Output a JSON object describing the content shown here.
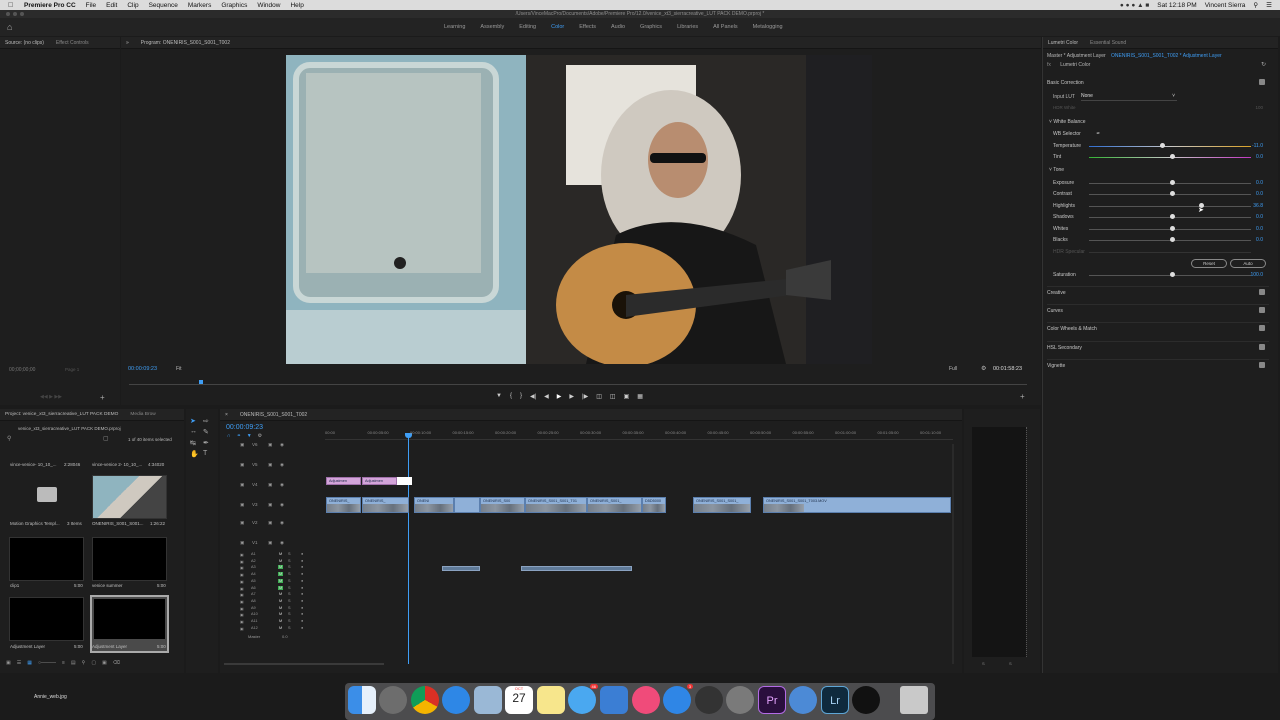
{
  "menubar": {
    "app": "Premiere Pro CC",
    "items": [
      "File",
      "Edit",
      "Clip",
      "Sequence",
      "Markers",
      "Graphics",
      "Window",
      "Help"
    ],
    "clock": "Sat 12:18 PM",
    "user": "Vincent Sierra"
  },
  "titlebar": {
    "path": "/Users/VinceMacPro/Documents/Adobe/Premiere Pro/12.0/venice_xt3_sierracreative_LUT PACK DEMO.prproj *"
  },
  "workspaces": {
    "tabs": [
      "Learning",
      "Assembly",
      "Editing",
      "Color",
      "Effects",
      "Audio",
      "Graphics",
      "Libraries",
      "All Panels",
      "Metalogging"
    ],
    "active": "Color"
  },
  "source": {
    "tab1": "Source: (no clips)",
    "tab2": "Effect Controls",
    "timecode": "00;00;00;00",
    "page": "Page 1"
  },
  "program": {
    "tab": "Program: ONENIRIS_S001_S001_T002",
    "timecode": "00:00:09:23",
    "fit": "Fit",
    "quality": "Full",
    "duration": "00:01:58:23"
  },
  "lumetri": {
    "tab1": "Lumetri Color",
    "tab2": "Essential Sound",
    "master": "Master * Adjustment Layer",
    "clip": "ONENIRIS_S001_S001_T002 * Adjustment Layer",
    "fx_label": "fx",
    "fx_name": "Lumetri Color",
    "basic": "Basic Correction",
    "input_lut_label": "Input LUT",
    "input_lut": "None",
    "hdr_white": "HDR White",
    "hdr_white_val": "100",
    "white_balance": "White Balance",
    "wb_selector": "WB Selector",
    "tone": "Tone",
    "hdr_specular": "HDR Specular",
    "reset": "Reset",
    "auto": "Auto",
    "sliders": [
      {
        "label": "Temperature",
        "value": "-11.0",
        "pos": 0.44
      },
      {
        "label": "Tint",
        "value": "0.0",
        "pos": 0.5
      },
      {
        "label": "Exposure",
        "value": "0.0",
        "pos": 0.5
      },
      {
        "label": "Contrast",
        "value": "0.0",
        "pos": 0.5
      },
      {
        "label": "Highlights",
        "value": "36.8",
        "pos": 0.68
      },
      {
        "label": "Shadows",
        "value": "0.0",
        "pos": 0.5
      },
      {
        "label": "Whites",
        "value": "0.0",
        "pos": 0.5
      },
      {
        "label": "Blacks",
        "value": "0.0",
        "pos": 0.5
      }
    ],
    "saturation": {
      "label": "Saturation",
      "value": "100.0",
      "pos": 0.5
    },
    "sections": [
      "Creative",
      "Curves",
      "Color Wheels & Match",
      "HSL Secondary",
      "Vignette"
    ]
  },
  "project": {
    "tab": "Project: venice_xt3_sierracreative_LUT PACK DEMO",
    "tab2": "Media Brow",
    "file": "venice_xt3_sierracreative_LUT PACK DEMO.prproj",
    "count": "1 of 40 items selected",
    "items": [
      {
        "name": "vince-venice- 10_10_...",
        "dur": "2:28046"
      },
      {
        "name": "vince-venice 2- 10_10_...",
        "dur": "4:34020"
      },
      {
        "name": "Motion Graphics Templ...",
        "dur": "3 Items"
      },
      {
        "name": "ONENIRIS_S001_S001...",
        "dur": "1:26:22"
      },
      {
        "name": "clip1",
        "dur": "5:00"
      },
      {
        "name": "venice summer",
        "dur": "5:00"
      },
      {
        "name": "Adjustment Layer",
        "dur": "5:00"
      },
      {
        "name": "Adjustment Layer",
        "dur": "5:00"
      }
    ]
  },
  "timeline": {
    "tab": "ONENIRIS_S001_S001_T002",
    "timecode": "00:00:09:23",
    "ruler": [
      "00:00",
      "00:00:05:00",
      "00:00:10:00",
      "00:00:15:00",
      "00:00:20:00",
      "00:00:25:00",
      "00:00:30:00",
      "00:00:35:00",
      "00:00:40:00",
      "00:00:45:00",
      "00:00:50:00",
      "00:00:55:00",
      "00:01:00:00",
      "00:01:05:00",
      "00:01:10:00"
    ],
    "video_tracks": [
      "V6",
      "V5",
      "V4",
      "V3",
      "V2",
      "V1"
    ],
    "audio_tracks": [
      "A1",
      "A2",
      "A3",
      "A4",
      "A5",
      "A6",
      "A7",
      "A8",
      "A9",
      "A10",
      "A11",
      "A12"
    ],
    "master": "Master",
    "master_val": "0.0",
    "adj_clips": [
      "Adjustmen",
      "Adjustmen"
    ],
    "v_clips": [
      "ONENIRIS_",
      "ONENIRIS_",
      "ONENI",
      "ONENIRIS_S00",
      "ONENIRIS_S001_S001_T01",
      "ONENIRIS_S001_",
      "D5D5000",
      "ONENIRIS_S001_S001_",
      "ONENIRIS_S001_S001_T003.MOV"
    ]
  },
  "dock": {
    "label": "Annie_web.jpg",
    "calendar_month": "OCT",
    "calendar_day": "27",
    "mail_badge": "46",
    "app_badge": "3"
  }
}
